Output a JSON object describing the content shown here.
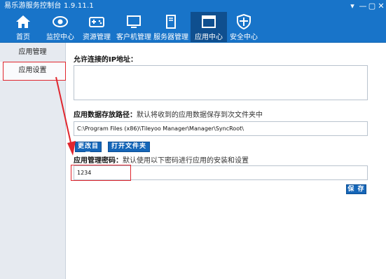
{
  "window": {
    "title": "易乐游服务控制台 1.9.11.1",
    "controls": [
      "▾",
      "—",
      "▢",
      "✕"
    ]
  },
  "nav": {
    "items": [
      {
        "label": "首页",
        "icon": "home-icon"
      },
      {
        "label": "监控中心",
        "icon": "eye-icon"
      },
      {
        "label": "资源管理",
        "icon": "gamepad-icon"
      },
      {
        "label": "客户机管理",
        "icon": "monitor-icon"
      },
      {
        "label": "服务器管理",
        "icon": "server-icon"
      },
      {
        "label": "应用中心",
        "icon": "app-center-icon",
        "active": true
      },
      {
        "label": "安全中心",
        "icon": "shield-icon"
      }
    ]
  },
  "sidebar": {
    "items": [
      {
        "label": "应用管理"
      },
      {
        "label": "应用设置",
        "active": true
      }
    ]
  },
  "main": {
    "allowed_ip": {
      "label": "允许连接的IP地址：",
      "value": ""
    },
    "storage_path": {
      "label": "应用数据存放路径：",
      "hint": "默认将收到的应用数据保存到次文件夹中",
      "value": "C:\\Program Files (x86)\\Tileyoo Manager\\Manager\\SyncRoot\\"
    },
    "buttons": {
      "change_dir": "更改目录",
      "open_folder": "打开文件夹",
      "save": "保 存"
    },
    "password": {
      "label": "应用管理密码：",
      "hint": "默认使用以下密码进行应用的安装和设置",
      "value": "1234"
    }
  },
  "colors": {
    "brand": "#1874c9",
    "nav_active": "#0f4f8f",
    "button": "#1566b8",
    "annotation": "#e0262e"
  }
}
